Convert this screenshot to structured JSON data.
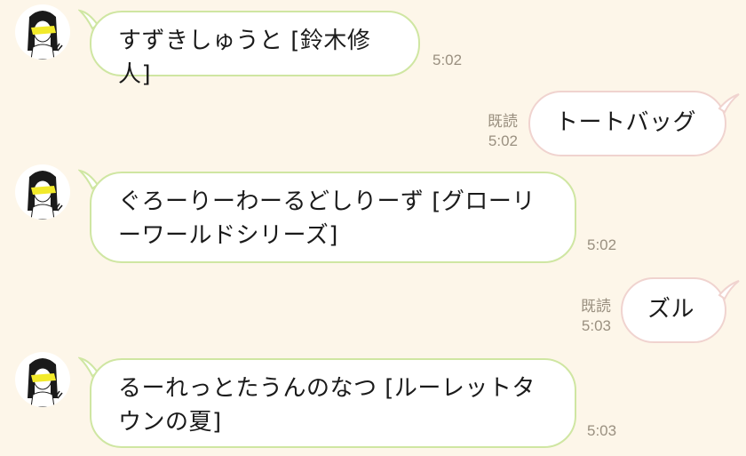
{
  "messages": [
    {
      "text": "すずきしゅうと [鈴木修人]",
      "time": "5:02"
    },
    {
      "text": "トートバッグ",
      "read": "既読",
      "time": "5:02"
    },
    {
      "text": "ぐろーりーわーるどしりーず [グローリーワールドシリーズ]",
      "time": "5:02"
    },
    {
      "text": "ズル",
      "read": "既読",
      "time": "5:03"
    },
    {
      "text": "るーれっとたうんのなつ [ルーレットタウンの夏]",
      "time": "5:03"
    }
  ],
  "colors": {
    "background": "#fdf6e9",
    "incoming_border": "#cfe6a2",
    "outgoing_border": "#f0d3cf",
    "avatar_highlight": "#f2ea2a"
  }
}
